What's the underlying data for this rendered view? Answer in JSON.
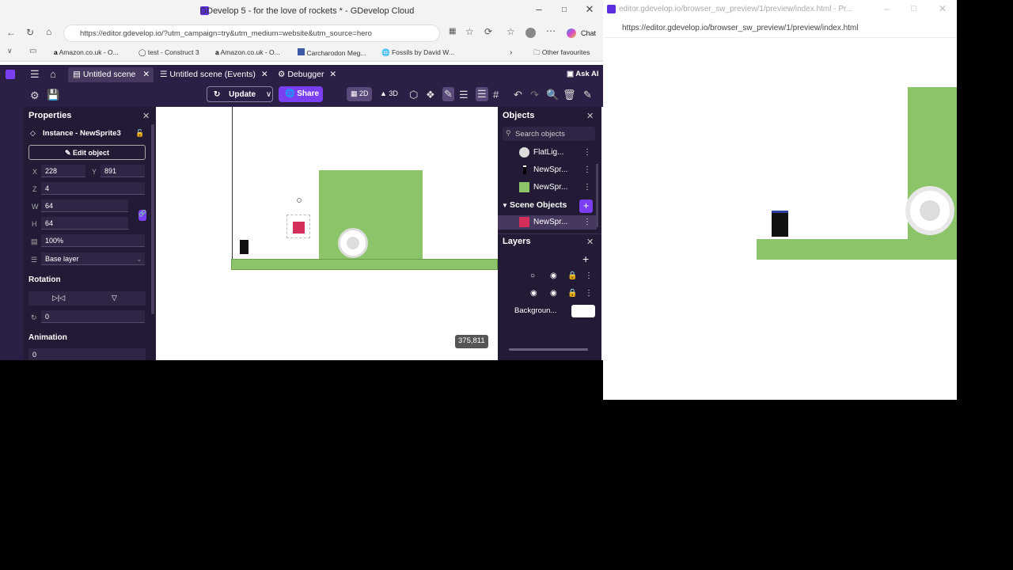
{
  "window1": {
    "title": "GDevelop 5 - for the love of rockets * - GDevelop Cloud",
    "url": "https://editor.gdevelop.io/?utm_campaign=try&utm_medium=website&utm_source=hero",
    "chat_label": "Chat",
    "bookmarks": [
      "Amazon.co.uk - O...",
      "test - Construct 3",
      "Amazon.co.uk - O...",
      "Carcharodon Meg...",
      "Fossils by David W..."
    ],
    "other_favourites": "Other favourites"
  },
  "app": {
    "tabs": [
      "Untitled scene",
      "Untitled scene (Events)",
      "Debugger"
    ],
    "ask_ai": "Ask AI",
    "update_label": "Update",
    "share_label": "Share",
    "mode_2d": "2D",
    "mode_3d": "3D"
  },
  "properties": {
    "title": "Properties",
    "instance_label": "Instance - NewSprite3",
    "edit_object": "Edit object",
    "x_label": "X",
    "x_value": "228",
    "y_label": "Y",
    "y_value": "891",
    "z_label": "Z",
    "z_value": "4",
    "w_label": "W",
    "w_value": "64",
    "h_label": "H",
    "h_value": "64",
    "opacity_value": "100%",
    "layer_value": "Base layer",
    "rotation_title": "Rotation",
    "angle_value": "0",
    "animation_title": "Animation",
    "animation_value": "0"
  },
  "scene": {
    "coords": "375,811"
  },
  "objects": {
    "title": "Objects",
    "search_placeholder": "Search objects",
    "items": [
      "FlatLig...",
      "NewSpr...",
      "NewSpr..."
    ],
    "scene_objects_title": "Scene Objects",
    "scene_items": [
      "NewSpr..."
    ],
    "layers_title": "Layers",
    "background_label": "Backgroun..."
  },
  "window2": {
    "title": "editor.gdevelop.io/browser_sw_preview/1/preview/index.html - Pr...",
    "url": "https://editor.gdevelop.io/browser_sw_preview/1/preview/index.html"
  },
  "colors": {
    "app_bg": "#2c1f45",
    "panel_bg": "#231a35",
    "accent": "#7b3ff2",
    "ground": "#8bc469",
    "sprite_red": "#d32f5a"
  }
}
